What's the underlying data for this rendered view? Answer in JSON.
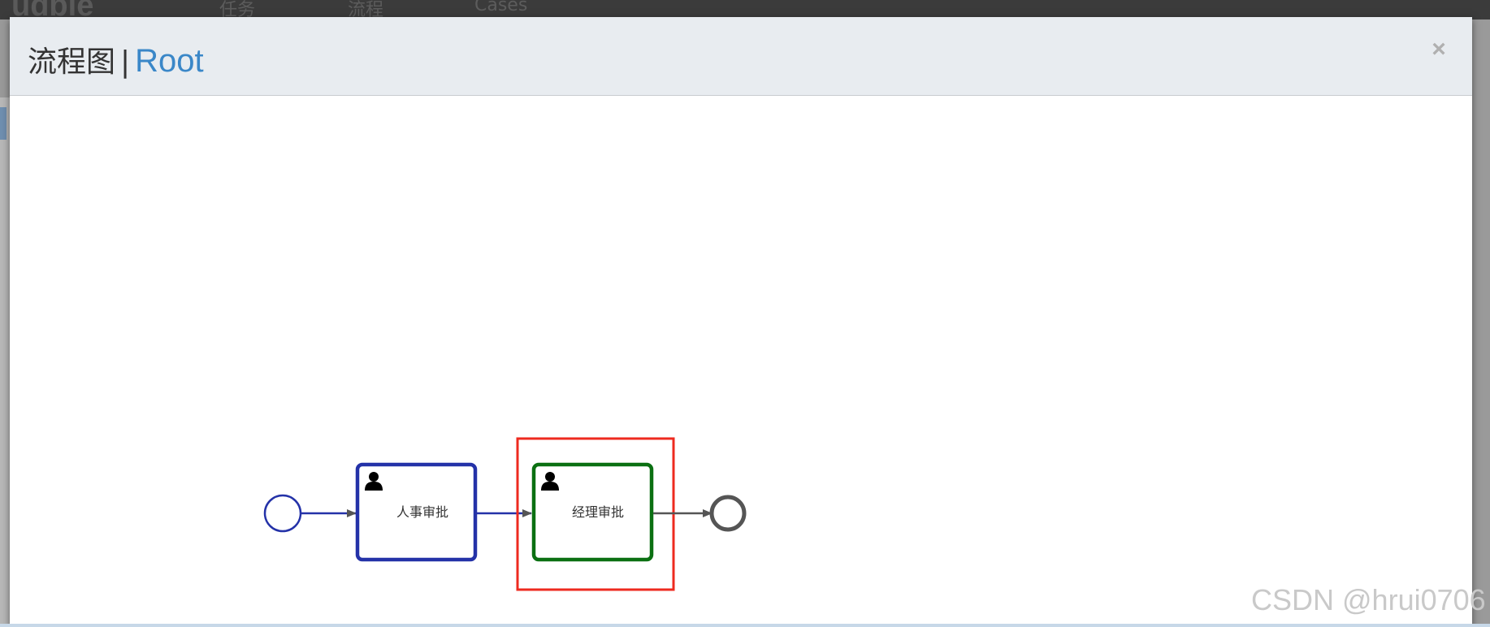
{
  "background": {
    "logo_text": "udble",
    "nav_items": [
      "任务",
      "流程",
      "Cases"
    ]
  },
  "modal": {
    "title": "流程图",
    "separator": "|",
    "subtitle": "Root",
    "close_label": "×"
  },
  "diagram": {
    "nodes": [
      {
        "type": "start-event"
      },
      {
        "type": "user-task",
        "label": "人事审批",
        "status": "completed",
        "color": "#2432a8"
      },
      {
        "type": "user-task",
        "label": "经理审批",
        "status": "current",
        "color": "#0b7012",
        "highlight": "#ee2a1f"
      },
      {
        "type": "end-event"
      }
    ]
  },
  "colors": {
    "completed": "#2432a8",
    "current": "#0b7012",
    "highlight": "#ee2a1f",
    "pending": "#555555",
    "title_accent": "#3a87c8"
  },
  "watermark": "CSDN @hrui0706"
}
